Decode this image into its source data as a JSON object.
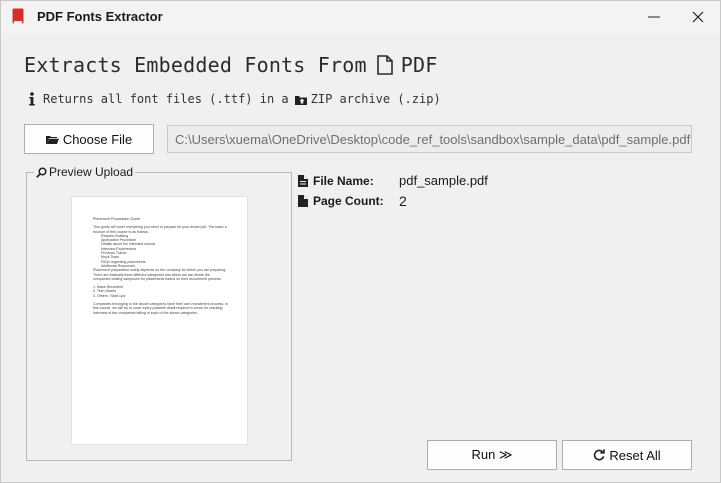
{
  "window": {
    "title": "PDF Fonts Extractor",
    "minimize_glyph": "—",
    "close_glyph": "✕"
  },
  "header": {
    "title_before_icon": "Extracts Embedded Fonts From",
    "title_after_icon": "PDF",
    "subtitle_before_icon": "Returns all font files (.ttf) in a",
    "subtitle_after_icon": "ZIP archive (.zip)"
  },
  "file_picker": {
    "button_label": "Choose File",
    "path_value": "C:\\Users\\xuema\\OneDrive\\Desktop\\code_ref_tools\\sandbox\\sample_data\\pdf_sample.pdf"
  },
  "preview": {
    "legend": "Preview Upload",
    "page_lines": [
      "Placement Preparation Guide",
      "",
      "This guide will cover everything you need to prepare for your dream job. The basic s-",
      "tructure of this course is as follows:",
      "    Resume Building",
      "    Application Procedure",
      "    Details about the interview rounds",
      "    Interview Experiences",
      "    Previous Tracks",
      "    Mock Tests",
      "    FAQs regarding placements",
      "    Additional Resources",
      "Placement preparation solely depends on the company for which you are preparing.",
      "There are basically three different categories into which we can divide the",
      "companies visiting campuses for placements based on their recruitment process.",
      "",
      "  1.  Mass Recruiters",
      "  2.  Tech Giants",
      "  3.  Others / Start-ups",
      "",
      "Companies belonging to the above categories have their own recruitment process. In",
      "this course, we will try to cover every possible detail required to know for cracking",
      "interview of the companies falling in each of the above categories."
    ]
  },
  "file_info": {
    "name_label": "File Name:",
    "name_value": "pdf_sample.pdf",
    "count_label": "Page Count:",
    "count_value": "2"
  },
  "actions": {
    "run_label": "Run ≫",
    "reset_label": "Reset All"
  },
  "colors": {
    "window_bg": "#f0f0f0",
    "app_icon": "#c62828",
    "button_border": "#adadad"
  },
  "icons": [
    "pdf-app-icon",
    "document-icon",
    "info-icon",
    "zip-folder-icon",
    "folder-icon",
    "magnifier-icon",
    "file-icon",
    "reload-icon"
  ]
}
